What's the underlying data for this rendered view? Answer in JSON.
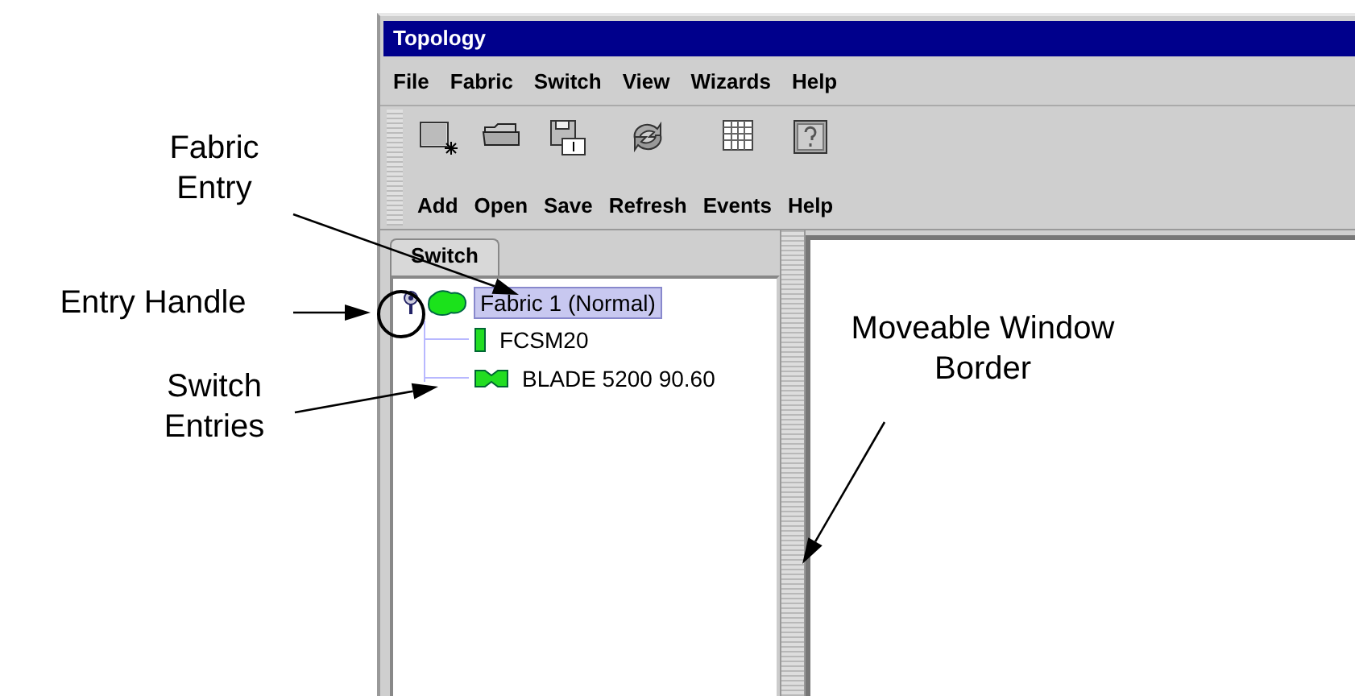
{
  "window": {
    "title": "Topology"
  },
  "menu": [
    "File",
    "Fabric",
    "Switch",
    "View",
    "Wizards",
    "Help"
  ],
  "toolbar": [
    {
      "label": "Add",
      "kind": "add"
    },
    {
      "label": "Open",
      "kind": "open"
    },
    {
      "label": "Save",
      "kind": "save"
    },
    {
      "label": "Refresh",
      "kind": "refresh"
    },
    {
      "label": "Events",
      "kind": "events"
    },
    {
      "label": "Help",
      "kind": "help"
    }
  ],
  "tabs": [
    {
      "label": "Switch",
      "selected": true
    }
  ],
  "tree": [
    {
      "label": "Fabric 1 (Normal)",
      "kind": "fabric",
      "selected": true,
      "expanded": true,
      "children": [
        {
          "label": "FCSM20",
          "kind": "module",
          "selected": false
        },
        {
          "label": "BLADE 5200 90.60",
          "kind": "blade",
          "selected": false
        }
      ]
    }
  ],
  "callouts": [
    {
      "text": "Fabric Entry"
    },
    {
      "text": "Entry Handle"
    },
    {
      "text": "Switch Entries"
    },
    {
      "text": "Moveable Window Border"
    }
  ]
}
